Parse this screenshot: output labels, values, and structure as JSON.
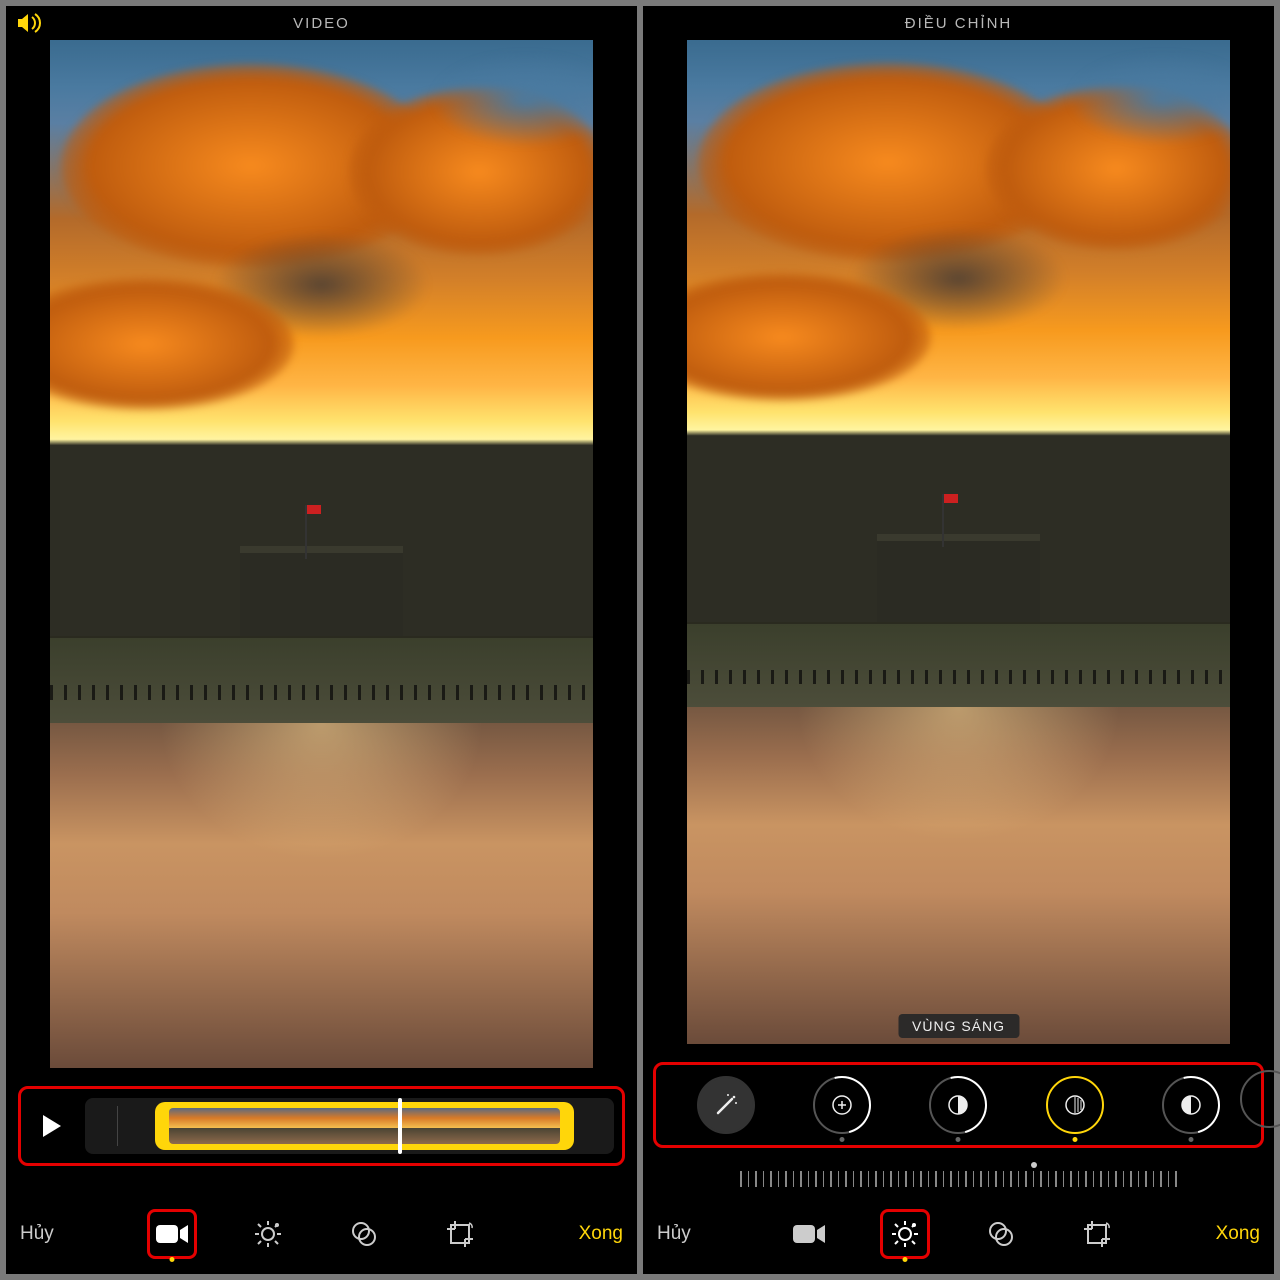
{
  "left": {
    "title": "VIDEO",
    "cancel": "Hủy",
    "done": "Xong",
    "tools": [
      "video",
      "adjust",
      "filters",
      "crop"
    ],
    "active_tool": "video"
  },
  "right": {
    "title": "ĐIỀU CHỈNH",
    "adjust_label": "VÙNG SÁNG",
    "cancel": "Hủy",
    "done": "Xong",
    "adjustments": [
      "auto",
      "exposure",
      "brilliance",
      "highlights",
      "contrast"
    ],
    "active_adjustment": "highlights",
    "tools": [
      "video",
      "adjust",
      "filters",
      "crop"
    ],
    "active_tool": "adjust"
  },
  "colors": {
    "accent": "#ffd60a",
    "highlight_box": "#e40000"
  }
}
